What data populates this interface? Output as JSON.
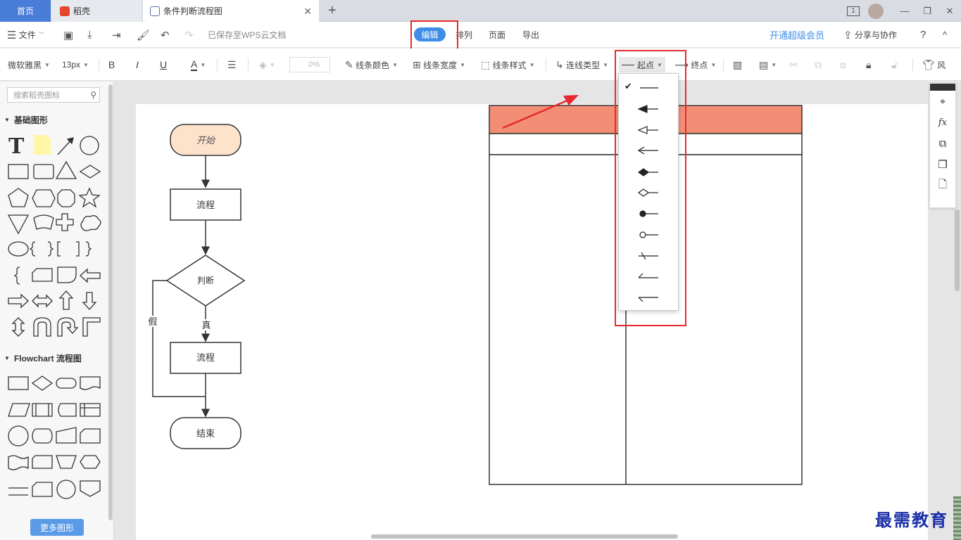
{
  "tabs": {
    "home": "首页",
    "daoke": "稻壳",
    "doc": "条件判断流程图",
    "add": "+",
    "close": "✕"
  },
  "window": {
    "badge": "1",
    "minimize": "—",
    "restore": "❐",
    "close": "✕"
  },
  "menubar": {
    "file": "文件",
    "saved_status": "已保存至WPS云文档",
    "menus": [
      "编辑",
      "排列",
      "页面",
      "导出"
    ],
    "vip": "开通超级会员",
    "share": "分享与协作",
    "help": "?",
    "collapse": "^"
  },
  "toolbar": {
    "font": "微软雅黑",
    "size": "13px",
    "bold": "B",
    "italic": "I",
    "underline": "U",
    "fontcolor": "A",
    "percent": "0%",
    "line_color": "线条颜色",
    "line_width": "线条宽度",
    "line_style": "线条样式",
    "connector_type": "连线类型",
    "start_point": "起点",
    "end_point": "终点",
    "more": "风"
  },
  "left_panel": {
    "search_placeholder": "搜索稻壳图标",
    "basic_title": "基础图形",
    "flow_title": "Flowchart 流程图",
    "more_button": "更多图形"
  },
  "flowchart": {
    "start": "开始",
    "process1": "流程",
    "decision": "判断",
    "false_label": "假",
    "true_label": "真",
    "process2": "流程",
    "end": "结束"
  },
  "colors": {
    "accent": "#3f8de6",
    "highlight": "#e8292e",
    "table_header": "#f38e76",
    "start_fill": "#fde2cc"
  },
  "dropdown": {
    "selected_index": 0,
    "options": [
      "none",
      "block-filled",
      "block-open",
      "classic-open",
      "diamond-filled",
      "diamond-open",
      "oval-filled",
      "oval-open",
      "dash",
      "half-arrow-up",
      "half-arrow-down"
    ]
  },
  "watermark": "最需教育"
}
